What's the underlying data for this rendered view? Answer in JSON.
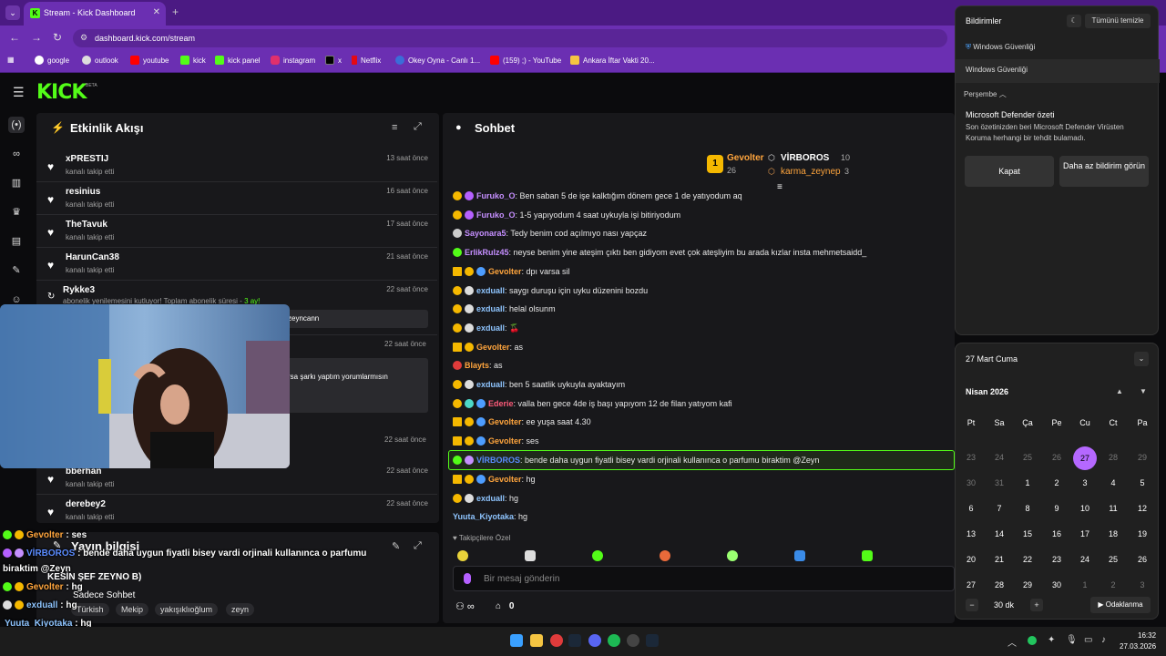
{
  "browser": {
    "tab_title": "Stream - Kick Dashboard",
    "url": "dashboard.kick.com/stream",
    "bookmarks": [
      "google",
      "outlook",
      "youtube",
      "kick",
      "kick panel",
      "instagram",
      "x",
      "Netflix",
      "Okey Oyna - Canlı 1...",
      "(159) ;) - YouTube",
      "Ankara İftar Vakti 20..."
    ]
  },
  "header": {
    "logo": "KICK",
    "beta": "BETA"
  },
  "activity": {
    "title": "Etkinlik Akışı",
    "rows": [
      {
        "name": "xPRESTIJ",
        "sub": "kanalı takip etti",
        "time": "13 saat önce"
      },
      {
        "name": "resinius",
        "sub": "kanalı takip etti",
        "time": "16 saat önce"
      },
      {
        "name": "TheTavuk",
        "sub": "kanalı takip etti",
        "time": "17 saat önce"
      },
      {
        "name": "HarunCan38",
        "sub": "kanalı takip etti",
        "time": "21 saat önce"
      }
    ],
    "resub": {
      "name": "Rykke3",
      "time": "22 saat önce",
      "text": "abonelik yenilemesini kutluyor! Toplam abonelik süresi - ",
      "months": "3 ay!",
      "msg": "zeyncann"
    },
    "row6": {
      "time": "22 saat önce",
      "msg": "rsa şarkı yaptım yorumlarmısın"
    },
    "row7_time": "22 saat önce",
    "bottom_rows": [
      {
        "name": "bberhan",
        "sub": "kanalı takip etti",
        "time": "22 saat önce"
      },
      {
        "name": "derebey2",
        "sub": "kanalı takip etti",
        "time": "22 saat önce"
      }
    ]
  },
  "stream_info": {
    "title": "Yayın bilgisi",
    "stream_title": "KESİN ŞEF ZEYNO B)",
    "chat_mode": "Sadece Sohbet",
    "tags": [
      "Türkish",
      "Mekip",
      "yakışıklıoğlum",
      "zeyn"
    ]
  },
  "chat": {
    "title": "Sohbet",
    "top_users": [
      {
        "name": "Gevolter",
        "count": "26"
      },
      {
        "name": "VİRBOROS",
        "count": "10"
      },
      {
        "name": "karma_zeynep",
        "count": "3"
      }
    ],
    "messages": [
      {
        "user": "Furuko_O",
        "color": "#c58fff",
        "text": "Ben saban 5 de işe kalktığım dönem gece 1 de yatıyodum aq"
      },
      {
        "user": "Furuko_O",
        "color": "#c58fff",
        "text": "1-5 yapıyodum 4 saat uykuyla işi bitiriyodum"
      },
      {
        "user": "Sayonara5",
        "color": "#c58fff",
        "text": "Tedy benim cod açılmıyo nası yapçaz"
      },
      {
        "user": "ErlikRulz45",
        "color": "#c58fff",
        "text": "neyse benim yine ateşim çıktı ben gidiyom evet çok ateşliyim bu arada kızlar insta mehmetsaidd_"
      },
      {
        "user": "Gevolter",
        "color": "#ffa53d",
        "text": "dpı varsa sil"
      },
      {
        "user": "exduall",
        "color": "#8fc5ff",
        "text": "saygı duruşu için uyku düzenini bozdu"
      },
      {
        "user": "exduall",
        "color": "#8fc5ff",
        "text": "helal olsunm"
      },
      {
        "user": "exduall",
        "color": "#8fc5ff",
        "text": "🍒"
      },
      {
        "user": "Gevolter",
        "color": "#ffa53d",
        "text": "as"
      },
      {
        "user": "Blayts",
        "color": "#ffa53d",
        "text": "as"
      },
      {
        "user": "exduall",
        "color": "#8fc5ff",
        "text": "ben 5 saatlik uykuyla ayaktayım"
      },
      {
        "user": "Ederie",
        "color": "#ff5b7a",
        "text": "valla ben gece 4de iş başı yapıyom 12 de filan yatıyom kafi"
      },
      {
        "user": "Gevolter",
        "color": "#ffa53d",
        "text": "ee yuşa saat 4.30"
      },
      {
        "user": "Gevolter",
        "color": "#ffa53d",
        "text": "ses"
      },
      {
        "user": "VİRBOROS",
        "color": "#5b8cff",
        "text": "bende daha uygun fiyatli bisey vardi orjinali kullanınca o parfumu biraktim @Zeyn"
      },
      {
        "user": "Gevolter",
        "color": "#ffa53d",
        "text": "hg"
      },
      {
        "user": "exduall",
        "color": "#8fc5ff",
        "text": "hg"
      },
      {
        "user": "Yuuta_Kiyotaka",
        "color": "#8fc5ff",
        "text": "hg"
      }
    ],
    "followers_only": "Takipçilere Özel",
    "input_placeholder": "Bir mesaj gönderin",
    "points": "∞",
    "shop_count": "0"
  },
  "overlay_chat": [
    {
      "user": "Gevolter",
      "text": "ses"
    },
    {
      "user": "VİRBOROS",
      "text": "bende daha uygun fiyatli bisey vardi orjinali kullanınca o parfumu"
    },
    {
      "user": "",
      "text": "biraktim @Zeyn"
    },
    {
      "user": "Gevolter",
      "text": "hg"
    },
    {
      "user": "exduall",
      "text": "hg"
    },
    {
      "user": "Yuuta_Kiyotaka",
      "text": "hg"
    }
  ],
  "notifications": {
    "title": "Bildirimler",
    "clear_all": "Tümünü temizle",
    "app1": "Windows Güvenliği",
    "app2": "Windows Güvenliği",
    "day": "Perşembe",
    "heading": "Microsoft Defender özeti",
    "body": "Son özetinizden beri Microsoft Defender Virüsten Koruma herhangi bir tehdit bulamadı.",
    "btn_close": "Kapat",
    "btn_less": "Daha az bildirim görün"
  },
  "calendar": {
    "date_header": "27 Mart Cuma",
    "month": "Nisan 2026",
    "weekdays": [
      "Pt",
      "Sa",
      "Ça",
      "Pe",
      "Cu",
      "Ct",
      "Pa"
    ],
    "weeks": [
      [
        "23",
        "24",
        "25",
        "26",
        "27",
        "28",
        "29"
      ],
      [
        "30",
        "31",
        "1",
        "2",
        "3",
        "4",
        "5"
      ],
      [
        "6",
        "7",
        "8",
        "9",
        "10",
        "11",
        "12"
      ],
      [
        "13",
        "14",
        "15",
        "16",
        "17",
        "18",
        "19"
      ],
      [
        "20",
        "21",
        "22",
        "23",
        "24",
        "25",
        "26"
      ],
      [
        "27",
        "28",
        "29",
        "30",
        "1",
        "2",
        "3"
      ]
    ],
    "focus_minutes": "30 dk",
    "focus_label": "Odaklanma"
  },
  "taskbar": {
    "time": "16:32",
    "date": "27.03.2026"
  }
}
